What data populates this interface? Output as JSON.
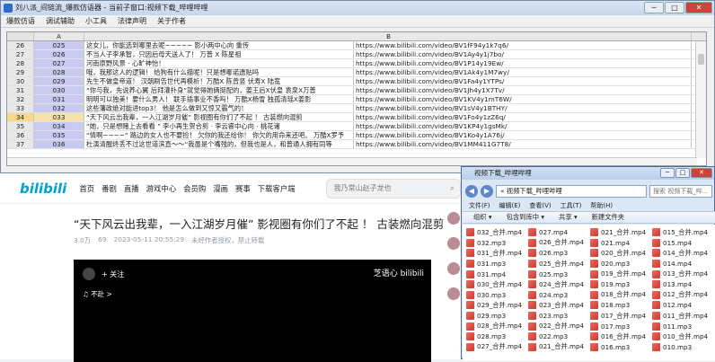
{
  "app": {
    "title": "刘八派_间链流_爆款仿语器 - 当前子窗口:视频下载_哔哩哔哩",
    "controls": [
      "─",
      "□",
      "✕"
    ],
    "menu": [
      "爆款仿语",
      "调试辅助",
      "小工具",
      "法律声明",
      "关于作者"
    ],
    "columns": [
      "",
      "A",
      "B",
      ""
    ],
    "rows": [
      {
        "n": "26",
        "id": "025",
        "text": "这女儿，你能选到哪里去呢~~~~~ 影小两中心向 重传",
        "url": "https://www.bilibili.com/video/BV1fF94y1k7q6/"
      },
      {
        "n": "27",
        "id": "026",
        "text": "不当人子李承智，只因后母天送人了！ 万普 X 陈星祖",
        "url": "https://www.bilibili.com/video/BV1Ay4y1j7bo/"
      },
      {
        "n": "28",
        "id": "027",
        "text": "河南原野风景 - 心旷神怡！",
        "url": "https://www.bilibili.com/video/BV1P14y19Ew/"
      },
      {
        "n": "29",
        "id": "028",
        "text": "哦，我那这人的逻辑！ 给狗有什么描呢！只是想哪诺遗贴吗",
        "url": "https://www.bilibili.com/video/BV1Ak4y1M7wy/"
      },
      {
        "n": "30",
        "id": "029",
        "text": "先生不做皇帝道！ 汉朝刷告世代再模析！万酷X 陈曾竖 伏寿X 陆宽",
        "url": "https://www.bilibili.com/video/BV1Fa4y1YTPs/"
      },
      {
        "n": "31",
        "id": "030",
        "text": "“你与我，先说养心翼 后拜灌扑身”就觉得她俩挺配的，姜王后X伏皇 袁泉X万普",
        "url": "https://www.bilibili.com/video/BV1Jh4y1X7Tv/"
      },
      {
        "n": "32",
        "id": "031",
        "text": "明明可以独美！要什么男人！ 联手插事业不香吗！ 万酷X杨雪 独孤清瑶X姜影",
        "url": "https://www.bilibili.com/video/BV1KV4y1mT6W/"
      },
      {
        "n": "33",
        "id": "032",
        "text": "这些藩政绝对能进top3！ 他是怎么做到又惊又霸气的！",
        "url": "https://www.bilibili.com/video/BV1sV4y1BTHY/"
      },
      {
        "n": "34",
        "id": "033",
        "text": "“天下风云出我辈，一入江湖岁月催” 影视圈有你们了不起 ！ 古装燃向混剪",
        "url": "https://www.bilibili.com/video/BV1Fo4y1zZ6q/"
      },
      {
        "n": "35",
        "id": "034",
        "text": "“她，只是想赌上去看看 ” 李小再生贺合剪 · 李云睿中心向 · 桃花诸",
        "url": "https://www.bilibili.com/video/BV1KP4y1gsMk/"
      },
      {
        "n": "36",
        "id": "035",
        "text": "“情啊~~~~” 路边的女人也不要捡！ 欠你的我还给你！ 你欠的用命来还吧。 万酷X罗予",
        "url": "https://www.bilibili.com/video/BV1Ko4y1A76j/"
      },
      {
        "n": "37",
        "id": "036",
        "text": "杜演清醒终丢不过这世道滨直～～“我虽是个嘴残的，但我也是人，和普通人拥有同等",
        "url": "https://www.bilibili.com/video/BV1MM411G7T8/"
      }
    ],
    "selected_row": "34"
  },
  "browser": {
    "logo": "bilibili",
    "nav": [
      "首页",
      "番剧",
      "直播",
      "游戏中心",
      "会员购",
      "漫画",
      "赛事",
      "下载客户端"
    ],
    "search_placeholder": "我乃常山赵子龙也",
    "video_title": "“天下风云出我辈，一入江湖岁月催” 影视圈有你们了不起 ！ 古装燃向混剪",
    "meta": [
      "3.0万",
      "69",
      "2023-05-11 20:55:29",
      "未经作者授权，禁止转载"
    ],
    "player": {
      "follow": "+ 关注",
      "name": "♫ 不赴 >",
      "brand": "芝语心 bilibili"
    }
  },
  "explorer": {
    "title": "视频下载_哔哩哔哩",
    "address": "« 视频下载_哔哩哔哩",
    "search_placeholder": "搜索 视频下载_哔...",
    "menu": [
      "文件(F)",
      "编辑(E)",
      "查看(V)",
      "工具(T)",
      "帮助(H)"
    ],
    "commands": [
      "组织 ▾",
      "包含到库中 ▾",
      "共享 ▾",
      "新建文件夹"
    ],
    "files": [
      "032_合并.mp4",
      "027.mp4",
      "021_合并.mp4",
      "015_合并.mp4",
      "032.mp3",
      "026_合并.mp4",
      "021.mp4",
      "015.mp4",
      "031_合并.mp4",
      "026.mp3",
      "020_合并.mp4",
      "014_合并.mp4",
      "031.mp3",
      "025_合并.mp4",
      "020.mp3",
      "014.mp4",
      "031.mp4",
      "025.mp3",
      "019_合并.mp4",
      "013_合并.mp4",
      "030_合并.mp4",
      "024_合并.mp4",
      "019.mp3",
      "013.mp4",
      "030.mp3",
      "024.mp3",
      "018_合并.mp4",
      "012_合并.mp4",
      "029_合并.mp4",
      "023_合并.mp4",
      "018.mp3",
      "012.mp4",
      "029.mp3",
      "023.mp3",
      "017_合并.mp4",
      "011_合并.mp4",
      "028_合并.mp4",
      "022_合并.mp4",
      "017.mp3",
      "011.mp3",
      "028.mp3",
      "022.mp3",
      "016_合并.mp4",
      "010_合并.mp4",
      "027_合并.mp4",
      "021_合并.mp4",
      "016.mp3",
      "010.mp3"
    ]
  }
}
